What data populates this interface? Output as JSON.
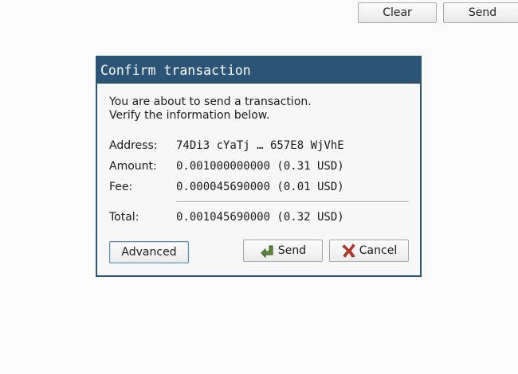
{
  "toolbar": {
    "clear_label": "Clear",
    "send_label": "Send"
  },
  "dialog": {
    "title": "Confirm transaction",
    "message_line1": "You are about to send a transaction.",
    "message_line2": "Verify the information below.",
    "address_label": "Address:",
    "address_value": "74Di3 cYaTj … 657E8 WjVhE",
    "amount_label": "Amount:",
    "amount_value": "0.001000000000 (0.31 USD)",
    "fee_label": "Fee:",
    "fee_value": "0.000045690000 (0.01 USD)",
    "total_label": "Total:",
    "total_value": "0.001045690000 (0.32 USD)",
    "advanced_label": "Advanced",
    "send_label": "Send",
    "cancel_label": "Cancel"
  },
  "colors": {
    "title_bar": "#2b5477",
    "dialog_bg": "#f7f7f7",
    "page_bg": "#fbfbfb",
    "send_icon": "#4a7a2a",
    "cancel_icon": "#c0392b"
  },
  "icons": {
    "send": "send-arrow-icon",
    "cancel": "cancel-x-icon"
  }
}
